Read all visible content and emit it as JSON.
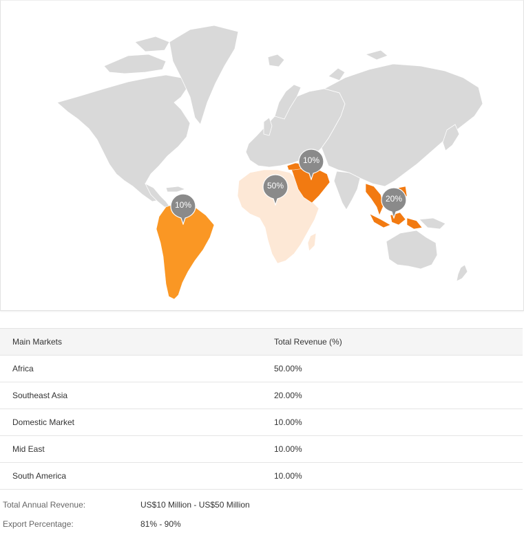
{
  "map": {
    "pins": [
      {
        "region": "South America",
        "label": "10%"
      },
      {
        "region": "Africa",
        "label": "50%"
      },
      {
        "region": "Mid East",
        "label": "10%"
      },
      {
        "region": "Southeast Asia",
        "label": "20%"
      }
    ],
    "colors": {
      "land": "#d9d9d9",
      "highlight": "#fa9724",
      "highlight_dark": "#f27a11",
      "highlight_light": "#fde8d6",
      "pin": "#8a8a8a"
    }
  },
  "table": {
    "headers": [
      "Main Markets",
      "Total Revenue (%)"
    ],
    "rows": [
      [
        "Africa",
        "50.00%"
      ],
      [
        "Southeast Asia",
        "20.00%"
      ],
      [
        "Domestic Market",
        "10.00%"
      ],
      [
        "Mid East",
        "10.00%"
      ],
      [
        "South America",
        "10.00%"
      ]
    ]
  },
  "summary": {
    "annual_revenue_label": "Total Annual Revenue:",
    "annual_revenue_value": "US$10 Million - US$50 Million",
    "export_label": "Export Percentage:",
    "export_value": "81% - 90%"
  }
}
